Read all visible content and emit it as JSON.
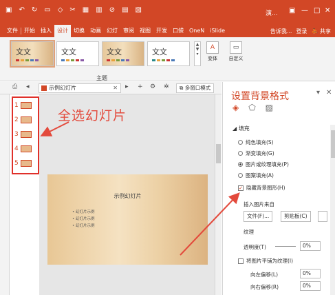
{
  "app": {
    "title": "演...",
    "qat_icons": [
      "save-icon",
      "undo-icon",
      "redo-icon",
      "new-icon",
      "shape-icon",
      "cut-icon",
      "table-icon",
      "chart-icon",
      "link-icon",
      "picture-icon",
      "photo-icon"
    ]
  },
  "tabs": [
    "文件",
    "开始",
    "插入",
    "设计",
    "切换",
    "动画",
    "幻灯",
    "审阅",
    "视图",
    "开发",
    "口袋",
    "OneN",
    "iSlide"
  ],
  "tabs_right": {
    "tell": "告诉我...",
    "login": "登录",
    "share": "共享"
  },
  "ribbon": {
    "themes": [
      {
        "text": "文文",
        "style": "wood"
      },
      {
        "text": "文文",
        "style": "plain"
      },
      {
        "text": "文文",
        "style": "wood"
      },
      {
        "text": "文文",
        "style": "plain"
      }
    ],
    "group_label": "主题",
    "variant_label": "变体",
    "custom_label": "自定义"
  },
  "toolbar2": {
    "tab_title": "示例幻灯片",
    "multi_window": "多窗口模式"
  },
  "thumbnails": [
    "1",
    "2",
    "3",
    "4",
    "5"
  ],
  "annotation": "全选幻灯片",
  "slide": {
    "title": "示例幻灯片",
    "bullets": [
      "幻灯片示例",
      "幻灯片示例",
      "幻灯片示例"
    ]
  },
  "pane": {
    "title": "设置背景格式",
    "section": "填充",
    "options": [
      "纯色填充(S)",
      "渐变填充(G)",
      "图片或纹理填充(P)",
      "图案填充(A)"
    ],
    "selected": 2,
    "hide_bg": "隐藏背景图形(H)",
    "insert_from": "插入图片来自",
    "file_btn": "文件(F)...",
    "clip_btn": "剪贴板(C)",
    "texture": "纹理",
    "transparency": "透明度(T)",
    "transparency_value": "0%",
    "tile": "将图片平铺为纹理(I)",
    "offset_left": "向左偏移(L)",
    "offset_left_value": "0%",
    "offset_right": "向右偏移(R)",
    "offset_right_value": "0%"
  }
}
